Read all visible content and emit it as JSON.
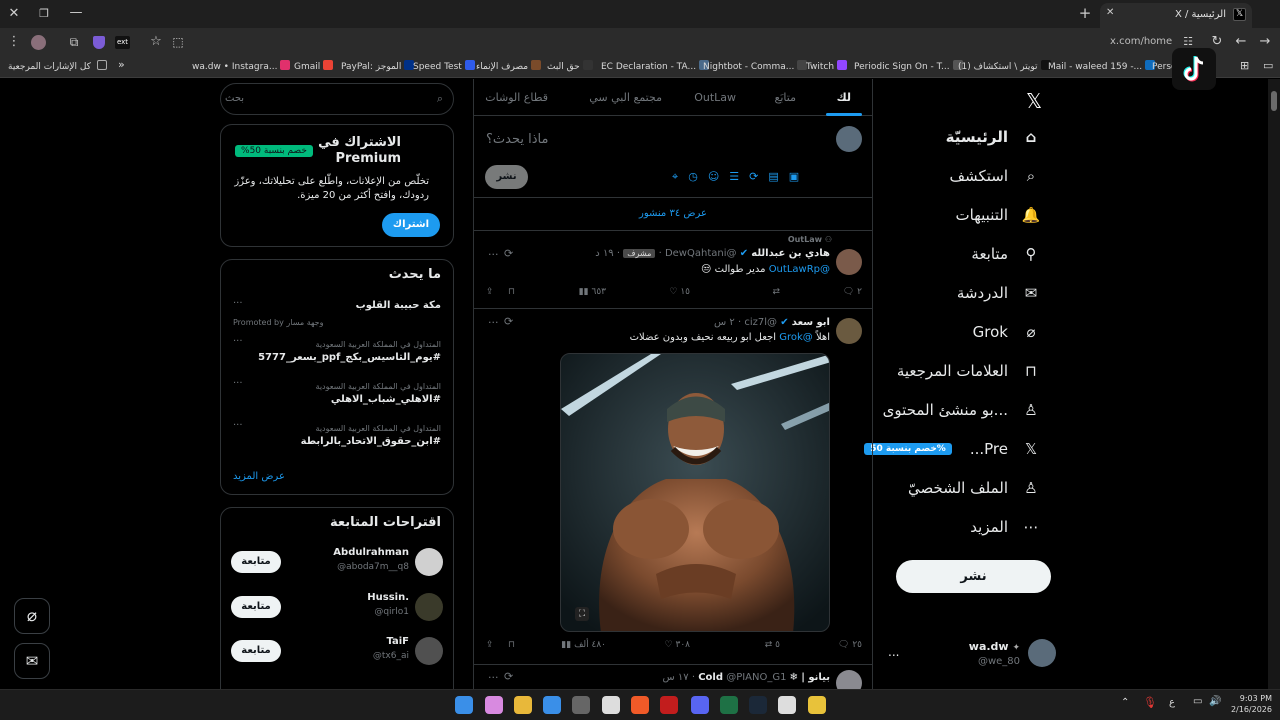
{
  "browser": {
    "active_tab_title": "الرئيسية / X",
    "new_tab": "+",
    "url": "x.com/home",
    "bookmarks": [
      {
        "label": "wa.dw • Instagra...",
        "color": "#e1306c"
      },
      {
        "label": "Gmail",
        "color": "#ea4335"
      },
      {
        "label": "PayPal: الموجز",
        "color": "#003087"
      },
      {
        "label": "Speed Test",
        "color": "#2f5bea"
      },
      {
        "label": "مصرف الإنماء",
        "color": "#7a4b2a"
      },
      {
        "label": "حق البث",
        "color": "#333333"
      },
      {
        "label": "EC Declaration - TA...",
        "color": "#4a6a8a"
      },
      {
        "label": "Nightbot - Comma...",
        "color": "#444444"
      },
      {
        "label": "Twitch",
        "color": "#9146ff"
      },
      {
        "label": "Periodic Sign On - T...",
        "color": "#555555"
      },
      {
        "label": "(1) تويتر \\ استكشاف",
        "color": "#111111"
      },
      {
        "label": "Mail - waleed 159 -...",
        "color": "#0f6cbd"
      },
      {
        "label": "Perso",
        "color": "#555555"
      }
    ],
    "all_bookmarks": "كل الإشارات المرجعية"
  },
  "nav": {
    "items": [
      {
        "label": "الرئيسيّة",
        "icon": "home-icon"
      },
      {
        "label": "استكشف",
        "icon": "search-icon"
      },
      {
        "label": "التنبيهات",
        "icon": "bell-icon"
      },
      {
        "label": "متابعة",
        "icon": "person-plus-icon"
      },
      {
        "label": "الدردشة",
        "icon": "mail-icon"
      },
      {
        "label": "Grok",
        "icon": "grok-icon"
      },
      {
        "label": "العلامات المرجعية",
        "icon": "bookmark-icon"
      },
      {
        "label": "...بو منشئ المحتوى",
        "icon": "creator-icon"
      },
      {
        "label": "Pre...",
        "icon": "x-logo-icon"
      },
      {
        "label": "الملف الشخصيّ",
        "icon": "profile-icon"
      },
      {
        "label": "المزيد",
        "icon": "more-icon"
      }
    ],
    "premium_badge": "%خصم بنسبة 50",
    "post_button": "نشر",
    "account": {
      "name": "wa.dw",
      "handle": "@we_80",
      "more": "..."
    }
  },
  "feed": {
    "tabs": [
      "لك",
      "متابَع",
      "OutLaw",
      "مجتمع البي سي",
      "قطاع الوشات"
    ],
    "compose_placeholder": "ماذا يحدث؟",
    "compose_post": "نشر",
    "show_posts": "عرض ٣٤ منشور",
    "tweets": [
      {
        "community": "OutLaw",
        "name": "هادي بن عبدالله",
        "handle": "@DewQahtani",
        "role": "مشرف",
        "time": "١٩ د",
        "reply_to": "@OutLawRp",
        "text": "مدير طوالت",
        "emoji": "😒",
        "stats": {
          "replies": "٢",
          "retweets": "",
          "likes": "١٥",
          "views": "٦٥٣"
        }
      },
      {
        "name": "ابو سعد",
        "handle": "@ciz7l",
        "time": "٢ س",
        "mention": "@Grok",
        "text_prefix": "اهلاً",
        "text": "اجعل ابو ربيعه نحيف وبدون عضلات",
        "stats": {
          "replies": "٢٥",
          "retweets": "٥",
          "likes": "٣٠٨",
          "views": "٤٨٠ ألف"
        }
      },
      {
        "name": "Cold",
        "prefix": "بيانو |",
        "handle": "@PIANO_G1",
        "time": "١٧ س"
      }
    ]
  },
  "sidebar": {
    "search_placeholder": "بحث",
    "premium": {
      "title": "الاشتراك في Premium",
      "discount": "%خصم بنسبة 50",
      "body": "تخلّص من الإعلانات، واطّلع على تحليلاتك، وعزّز ردودك، وافتح أكثر من 20 ميزة.",
      "button": "اشتراك"
    },
    "trends": {
      "title": "ما يحدث",
      "items": [
        {
          "context": "",
          "name": "مكة حبيبة القلوب",
          "promoted": "Promoted by وجهة مسار"
        },
        {
          "context": "المتداول في المملكة العربية السعودية",
          "name": "#يوم_التاسيس_بكج_ppf_بسعر_5777"
        },
        {
          "context": "المتداول في المملكة العربية السعودية",
          "name": "#الاهلي_شباب_الاهلي"
        },
        {
          "context": "المتداول في المملكة العربية السعودية",
          "name": "#ابن_حقوق_الاتحاد_بالرابطة"
        }
      ],
      "show_more": "عرض المزيد"
    },
    "follow": {
      "title": "اقتراحات المتابعة",
      "button": "متابعة",
      "users": [
        {
          "name": "Abdulrahman",
          "handle": "@aboda7m__q8"
        },
        {
          "name": "Hussin.",
          "handle": "@qirlo1"
        },
        {
          "name": "TaiF",
          "handle": "@tx6_ai"
        }
      ]
    }
  },
  "taskbar": {
    "time": "9:03 PM",
    "date": "2/16/2026",
    "lang": "ع"
  }
}
